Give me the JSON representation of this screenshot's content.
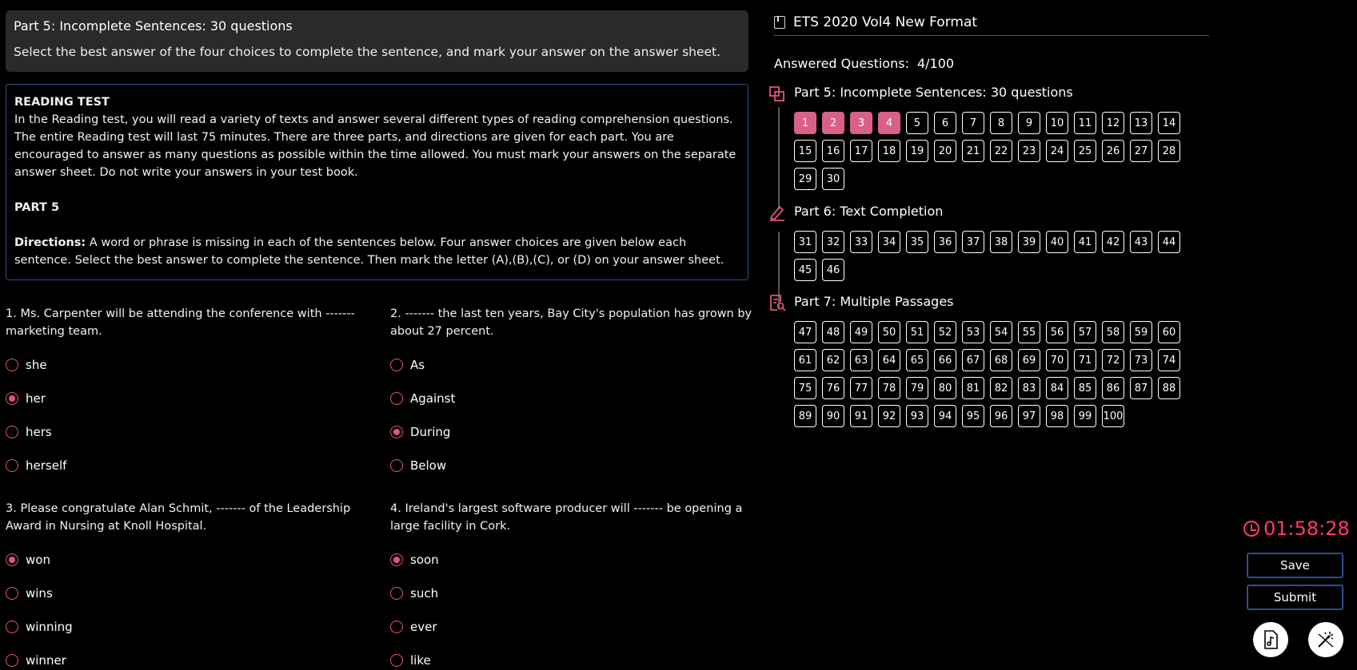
{
  "header": {
    "title": "Part 5: Incomplete Sentences: 30 questions",
    "subtitle": "Select the best answer of the four choices to complete the sentence, and mark your answer on the answer sheet."
  },
  "reading": {
    "heading": "READING TEST",
    "body": "In the Reading test, you will read a variety of texts and answer several different types of reading comprehension questions. The entire Reading test will last 75 minutes. There are three parts, and directions are given for each part. You are encouraged to answer as many questions as possible within the time allowed. You must mark your answers on the separate answer sheet. Do not write your answers in your test book.",
    "part_label": "PART 5",
    "directions_label": "Directions:",
    "directions_text": " A word or phrase is missing in each of the sentences below. Four answer choices are given below each sentence. Select the best answer to complete the sentence. Then mark the letter (A),(B),(C), or (D) on your answer sheet."
  },
  "questions": [
    {
      "text": "1. Ms. Carpenter will be attending the conference with ------- marketing team.",
      "options": [
        "she",
        "her",
        "hers",
        "herself"
      ],
      "selected": 1
    },
    {
      "text": "2. ------- the last ten years, Bay City's population has grown by about 27 percent.",
      "options": [
        "As",
        "Against",
        "During",
        "Below"
      ],
      "selected": 2
    },
    {
      "text": "3. Please congratulate Alan Schmit, ------- of the Leadership Award in Nursing at Knoll Hospital.",
      "options": [
        "won",
        "wins",
        "winning",
        "winner"
      ],
      "selected": 0
    },
    {
      "text": "4. Ireland's largest software producer will ------- be opening a large facility in Cork.",
      "options": [
        "soon",
        "such",
        "ever",
        "like"
      ],
      "selected": 0
    }
  ],
  "sidebar": {
    "test_title": "ETS 2020 Vol4 New Format",
    "answered_label": "Answered Questions:",
    "answered_value": "4/100",
    "parts": [
      {
        "title": "Part 5: Incomplete Sentences: 30 questions",
        "icon": "copy-icon",
        "start": 1,
        "end": 30
      },
      {
        "title": "Part 6: Text Completion",
        "icon": "pencil-icon",
        "start": 31,
        "end": 46
      },
      {
        "title": "Part 7: Multiple Passages",
        "icon": "document-search-icon",
        "start": 47,
        "end": 100
      }
    ],
    "answered": [
      1,
      2,
      3,
      4
    ],
    "accent_color": "#d9608a"
  },
  "timer": "01:58:28",
  "buttons": {
    "save": "Save",
    "submit": "Submit"
  }
}
